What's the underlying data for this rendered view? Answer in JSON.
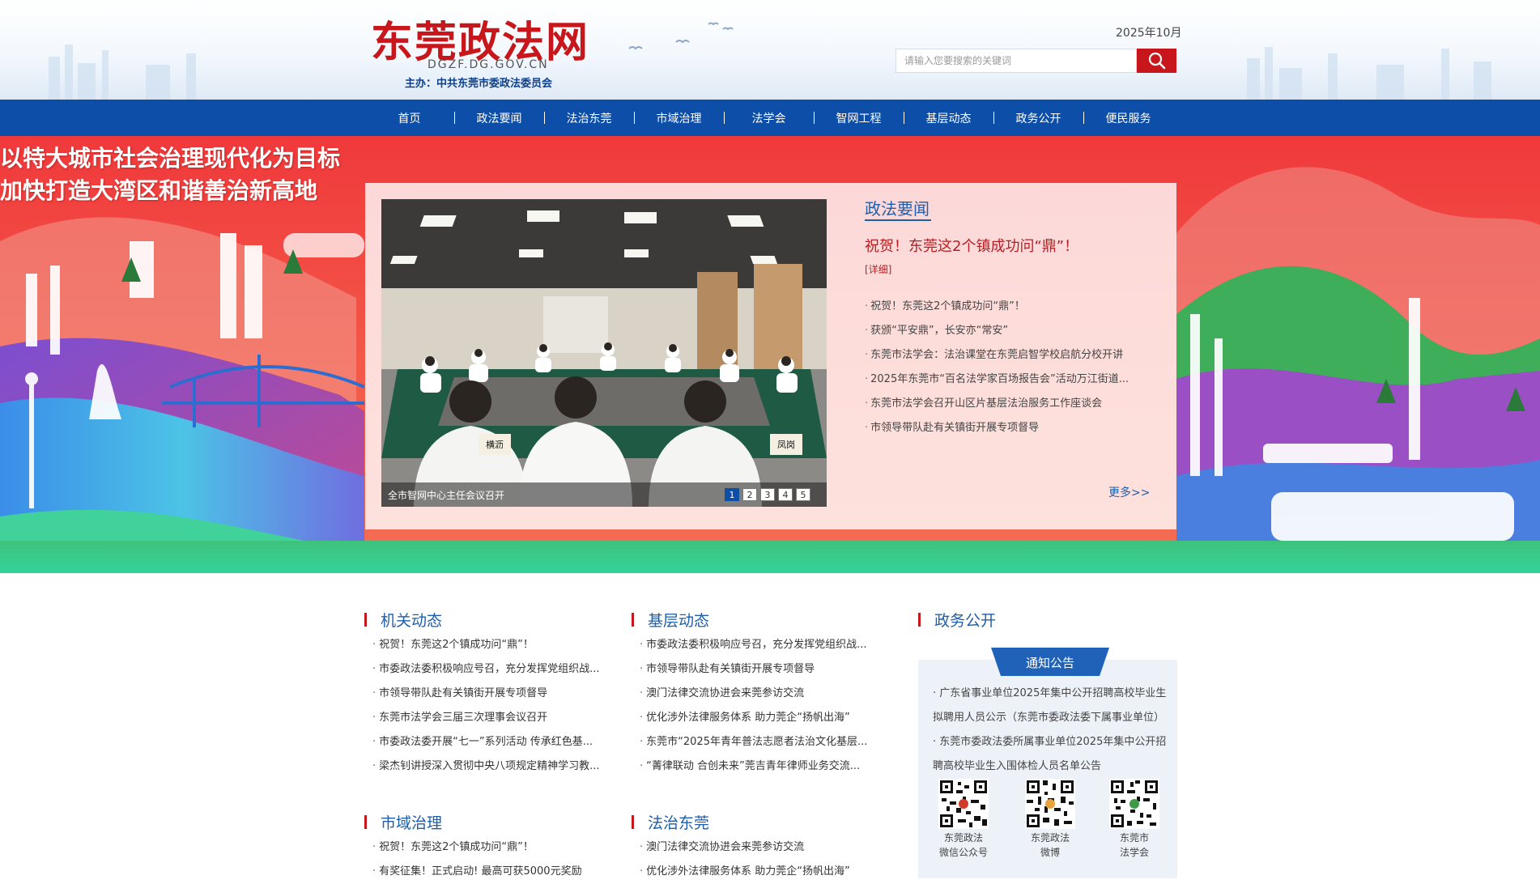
{
  "header": {
    "site_title": "东莞政法网",
    "domain": "DGZF.DG.GOV.CN",
    "host": "主办：中共东莞市委政法委员会",
    "date": "2025年10月",
    "search_placeholder": "请输入您要搜索的关键词",
    "search_icon": "search-icon"
  },
  "nav": {
    "items": [
      "首页",
      "政法要闻",
      "法治东莞",
      "市域治理",
      "法学会",
      "智网工程",
      "基层动态",
      "政务公开",
      "便民服务"
    ]
  },
  "hero": {
    "slogan_line1": "以特大城市社会治理现代化为目标",
    "slogan_line2": "加快打造大湾区和谐善治新高地",
    "slider": {
      "caption": "全市智网中心主任会议召开",
      "pages": [
        "1",
        "2",
        "3",
        "4",
        "5"
      ],
      "active_page": 1,
      "table_signs": [
        "横沥",
        "凤岗"
      ]
    },
    "zhengfa": {
      "heading": "政法要闻",
      "headline": "祝贺！东莞这2个镇成功问“鼎”！",
      "detail": "[详细]",
      "items": [
        "祝贺！东莞这2个镇成功问“鼎”！",
        "获颁“平安鼎”，长安亦“常安”",
        "东莞市法学会：法治课堂在东莞启智学校启航分校开讲",
        "2025年东莞市“百名法学家百场报告会”活动万江街道...",
        "东莞市法学会召开山区片基层法治服务工作座谈会",
        "市领导带队赴有关镇街开展专项督导"
      ],
      "more": "更多>>"
    }
  },
  "columns": {
    "jiguan": {
      "title": "机关动态",
      "items": [
        "祝贺！东莞这2个镇成功问“鼎”！",
        "市委政法委积极响应号召，充分发挥党组织战...",
        "市领导带队赴有关镇街开展专项督导",
        "东莞市法学会三届三次理事会议召开",
        "市委政法委开展“七一”系列活动 传承红色基...",
        "梁杰钊讲授深入贯彻中央八项规定精神学习教..."
      ]
    },
    "jiceng": {
      "title": "基层动态",
      "items": [
        "市委政法委积极响应号召，充分发挥党组织战...",
        "市领导带队赴有关镇街开展专项督导",
        "澳门法律交流协进会来莞参访交流",
        "优化涉外法律服务体系 助力莞企“扬帆出海”",
        "东莞市“2025年青年普法志愿者法治文化基层...",
        "“菁律联动 合创未来”莞吉青年律师业务交流..."
      ]
    },
    "zhengwu": {
      "title": "政务公开",
      "notice_tab": "通知公告",
      "notices": [
        "· 广东省事业单位2025年集中公开招聘高校毕业生",
        "拟聘用人员公示（东莞市委政法委下属事业单位）",
        "· 东莞市委政法委所属事业单位2025年集中公开招",
        "聘高校毕业生入围体检人员名单公告"
      ],
      "qrcodes": [
        {
          "line1": "东莞政法",
          "line2": "微信公众号"
        },
        {
          "line1": "东莞政法",
          "line2": "微博"
        },
        {
          "line1": "东莞市",
          "line2": "法学会"
        }
      ]
    },
    "shiyu": {
      "title": "市域治理",
      "items": [
        "祝贺！东莞这2个镇成功问“鼎”！",
        "有奖征集！正式启动! 最高可获5000元奖励"
      ]
    },
    "fazhi": {
      "title": "法治东莞",
      "items": [
        "澳门法律交流协进会来莞参访交流",
        "优化涉外法律服务体系 助力莞企“扬帆出海”"
      ]
    }
  },
  "colors": {
    "brand_red": "#c8161d",
    "nav_blue": "#0d4ea8",
    "link_blue": "#1f5eaa"
  }
}
